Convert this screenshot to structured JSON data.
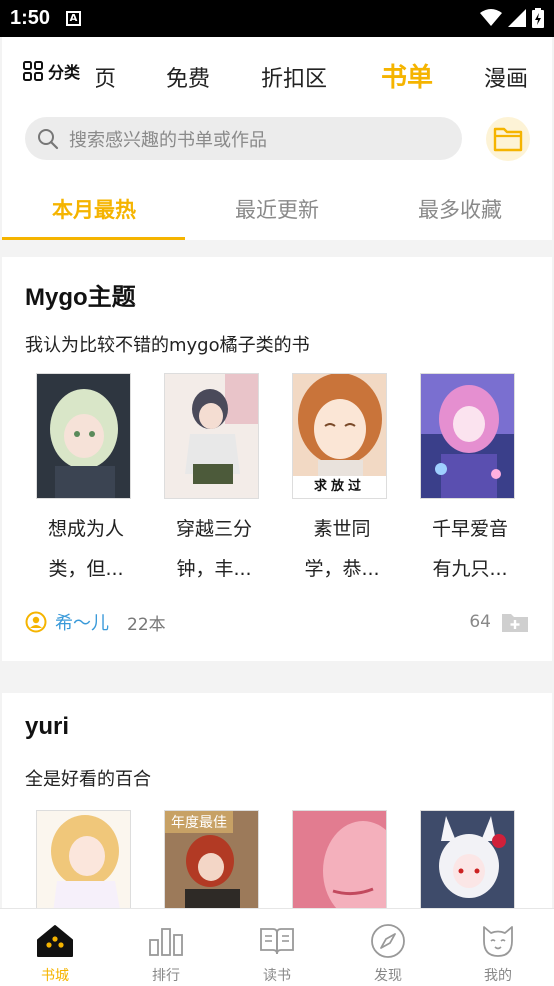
{
  "status_bar": {
    "time": "1:50",
    "notification_letter": "A"
  },
  "header": {
    "category_label": "分类",
    "tabs": [
      {
        "label": "页",
        "active": false
      },
      {
        "label": "免费",
        "active": false
      },
      {
        "label": "折扣区",
        "active": false
      },
      {
        "label": "书单",
        "active": true
      },
      {
        "label": "漫画",
        "active": false
      }
    ]
  },
  "search": {
    "placeholder": "搜索感兴趣的书单或作品"
  },
  "sub_tabs": [
    {
      "label": "本月最热",
      "active": true
    },
    {
      "label": "最近更新",
      "active": false
    },
    {
      "label": "最多收藏",
      "active": false
    }
  ],
  "booklists": [
    {
      "title": "Mygo主题",
      "description": "我认为比较不错的mygo橘子类的书",
      "books": [
        {
          "name_line1": "想成为人",
          "name_line2": "类，但..."
        },
        {
          "name_line1": "穿越三分",
          "name_line2": "钟，丰..."
        },
        {
          "name_line1": "素世同",
          "name_line2": "学，恭...",
          "cover_caption": "求放过"
        },
        {
          "name_line1": "千早爱音",
          "name_line2": "有九只..."
        }
      ],
      "author": "希〜儿",
      "book_count": "22本",
      "favorites": "64"
    },
    {
      "title": "yuri",
      "description": "全是好看的百合",
      "books": [
        {
          "badge": ""
        },
        {
          "badge": "年度最佳"
        },
        {
          "badge": ""
        },
        {
          "badge": ""
        }
      ]
    }
  ],
  "bottom_nav": [
    {
      "label": "书城",
      "icon": "home-icon",
      "active": true
    },
    {
      "label": "排行",
      "icon": "bar-chart-icon",
      "active": false
    },
    {
      "label": "读书",
      "icon": "open-book-icon",
      "active": false
    },
    {
      "label": "发现",
      "icon": "compass-icon",
      "active": false
    },
    {
      "label": "我的",
      "icon": "cat-face-icon",
      "active": false
    }
  ],
  "colors": {
    "accent": "#f5b400",
    "author_link": "#3a9ad9",
    "muted": "#8a8a8a"
  }
}
